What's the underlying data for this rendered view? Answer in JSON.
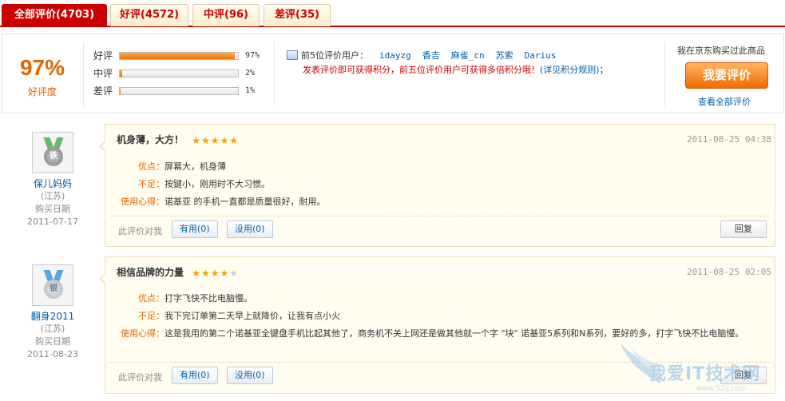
{
  "tabs": [
    {
      "label": "全部评价(4703)",
      "active": true
    },
    {
      "label": "好评(4572)",
      "active": false
    },
    {
      "label": "中评(96)",
      "active": false
    },
    {
      "label": "差评(35)",
      "active": false
    }
  ],
  "summary": {
    "good_rate": "97%",
    "good_rate_label": "好评度",
    "bars": [
      {
        "label": "好评",
        "pct": "97%",
        "value": 97
      },
      {
        "label": "中评",
        "pct": "2%",
        "value": 2
      },
      {
        "label": "差评",
        "pct": "1%",
        "value": 1
      }
    ],
    "top_users_label": "前5位评价用户：",
    "top_users": [
      "idayzg",
      "香吉",
      "麻雀_cn",
      "苏索",
      "Darius"
    ],
    "promo_text": "发表评价即可获得积分，前五位评价用户可获得多倍积分哦！",
    "promo_rule": "(详见积分规则)",
    "promo_tail": "；",
    "bought_label": "我在京东购买过此商品",
    "review_button": "我要评价",
    "view_all": "查看全部评价"
  },
  "reviews": [
    {
      "user": "保儿妈妈",
      "region": "(江苏)",
      "date_label": "购买日期",
      "buy_date": "2011-07-17",
      "medal": "铁",
      "title": "机身薄，大方！",
      "stars": 5,
      "date": "2011-08-25 04:38",
      "pros_label": "优点：",
      "pros": "屏幕大，机身薄",
      "cons_label": "不足：",
      "cons": "按键小，刚用时不大习惯。",
      "exp_label": "使用心得：",
      "exp": "诺基亚 的手机一直都是质量很好，耐用。",
      "ask": "此评价对我",
      "useful": "有用(0)",
      "useless": "没用(0)",
      "reply": "回复"
    },
    {
      "user": "翻身2011",
      "region": "(江苏)",
      "date_label": "购买日期",
      "buy_date": "2011-08-23",
      "medal": "银",
      "title": "相信品牌的力量",
      "stars": 4,
      "date": "2011-08-25 02:05",
      "pros_label": "优点：",
      "pros": "打字飞快不比电脑慢。",
      "cons_label": "不足：",
      "cons": "我下完订单第二天早上就降价，让我有点小火",
      "exp_label": "使用心得：",
      "exp": "这是我用的第二个诺基亚全键盘手机比起其他了，商务机不关上网还是做其他就一个字 \"块\" 诺基亚5系列和N系列，要好的多，打字飞快不比电脑慢。",
      "ask": "此评价对我",
      "useful": "有用(0)",
      "useless": "没用(0)",
      "reply": "回复"
    }
  ],
  "watermark": {
    "title": "我爱IT技术网",
    "url": "www.52ij.com"
  },
  "colors": {
    "accent": "#cc0000",
    "orange": "#e56600",
    "link": "#005ea7"
  }
}
